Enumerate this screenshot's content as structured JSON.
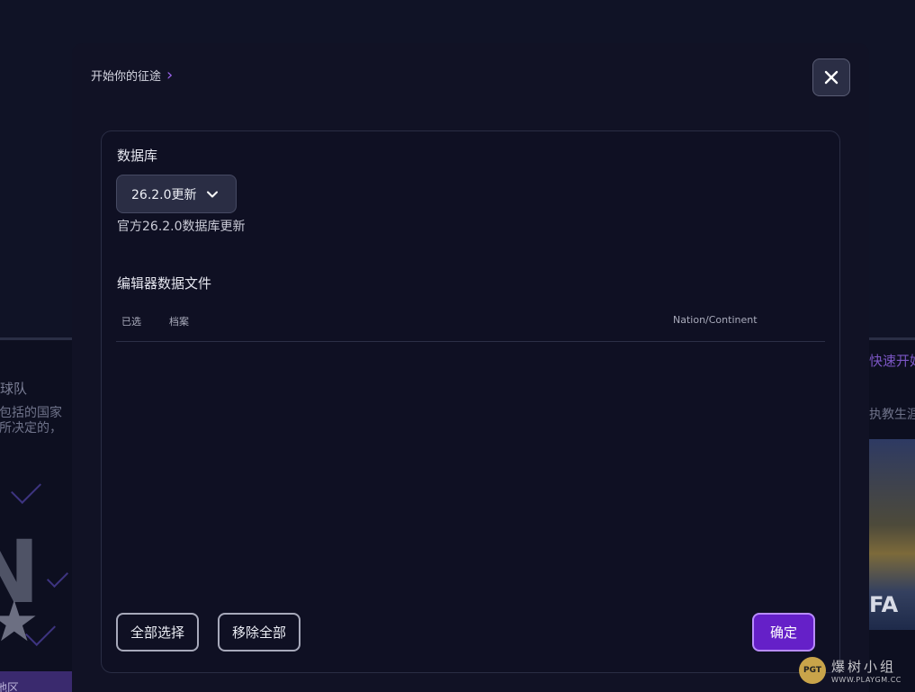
{
  "background": {
    "left_panel": {
      "title": "的球队",
      "desc_line1": "认包括的国家",
      "desc_line2": "部所决定的，",
      "bottom_bar_text": "地区"
    },
    "right_panel": {
      "link": "快速开始",
      "subtitle": "执教生涯",
      "art_text": "FA"
    }
  },
  "modal": {
    "breadcrumb": "开始你的征途",
    "database": {
      "title": "数据库",
      "selected_value": "26.2.0更新",
      "description": "官方26.2.0数据库更新"
    },
    "editor_files": {
      "title": "编辑器数据文件",
      "columns": {
        "selected": "已选",
        "profile": "档案",
        "nation": "Nation/Continent"
      },
      "rows": []
    },
    "buttons": {
      "select_all": "全部选择",
      "remove_all": "移除全部",
      "confirm": "确定"
    }
  },
  "watermark": {
    "logo_text": "PGT",
    "chinese": "爆树小组",
    "url": "WWW.PLAYGM.CC"
  },
  "colors": {
    "accent": "#6520c8",
    "accent_border": "#b88bff",
    "breadcrumb_arrow": "#9a63ea",
    "modal_bg": "#111225"
  },
  "icons": {
    "close": "close-icon",
    "dropdown": "chevron-down-icon",
    "breadcrumb": "chevron-right-icon"
  }
}
